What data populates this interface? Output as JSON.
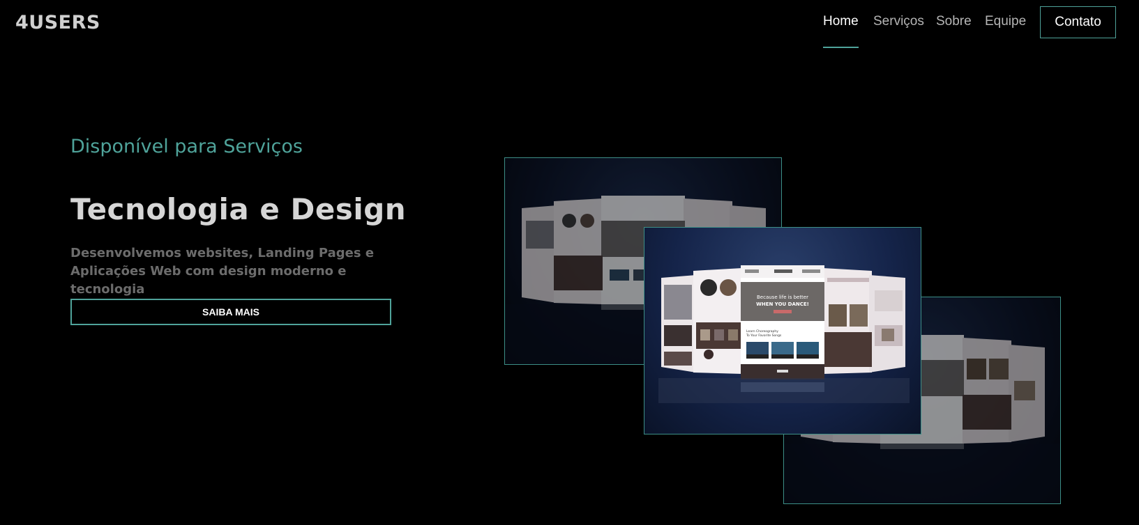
{
  "header": {
    "logo": "4USERS",
    "nav": [
      {
        "label": "Home",
        "active": true
      },
      {
        "label": "Serviços",
        "active": false
      },
      {
        "label": "Sobre",
        "active": false
      },
      {
        "label": "Equipe",
        "active": false
      }
    ],
    "contact_label": "Contato"
  },
  "hero": {
    "eyebrow": "Disponível para Serviços",
    "title": "Tecnologia e Design",
    "description": "Desenvolvemos websites, Landing Pages e Aplicações Web com design moderno e tecnologia",
    "cta_label": "SAIBA MAIS"
  },
  "mockup": {
    "headline_line1": "Because life is better",
    "headline_line2": "WHEN YOU DANCE!",
    "section_title_line1": "Learn Choreography",
    "section_title_line2": "To Your Favorite Songs"
  },
  "colors": {
    "accent": "#4fa39a",
    "background": "#000000"
  }
}
